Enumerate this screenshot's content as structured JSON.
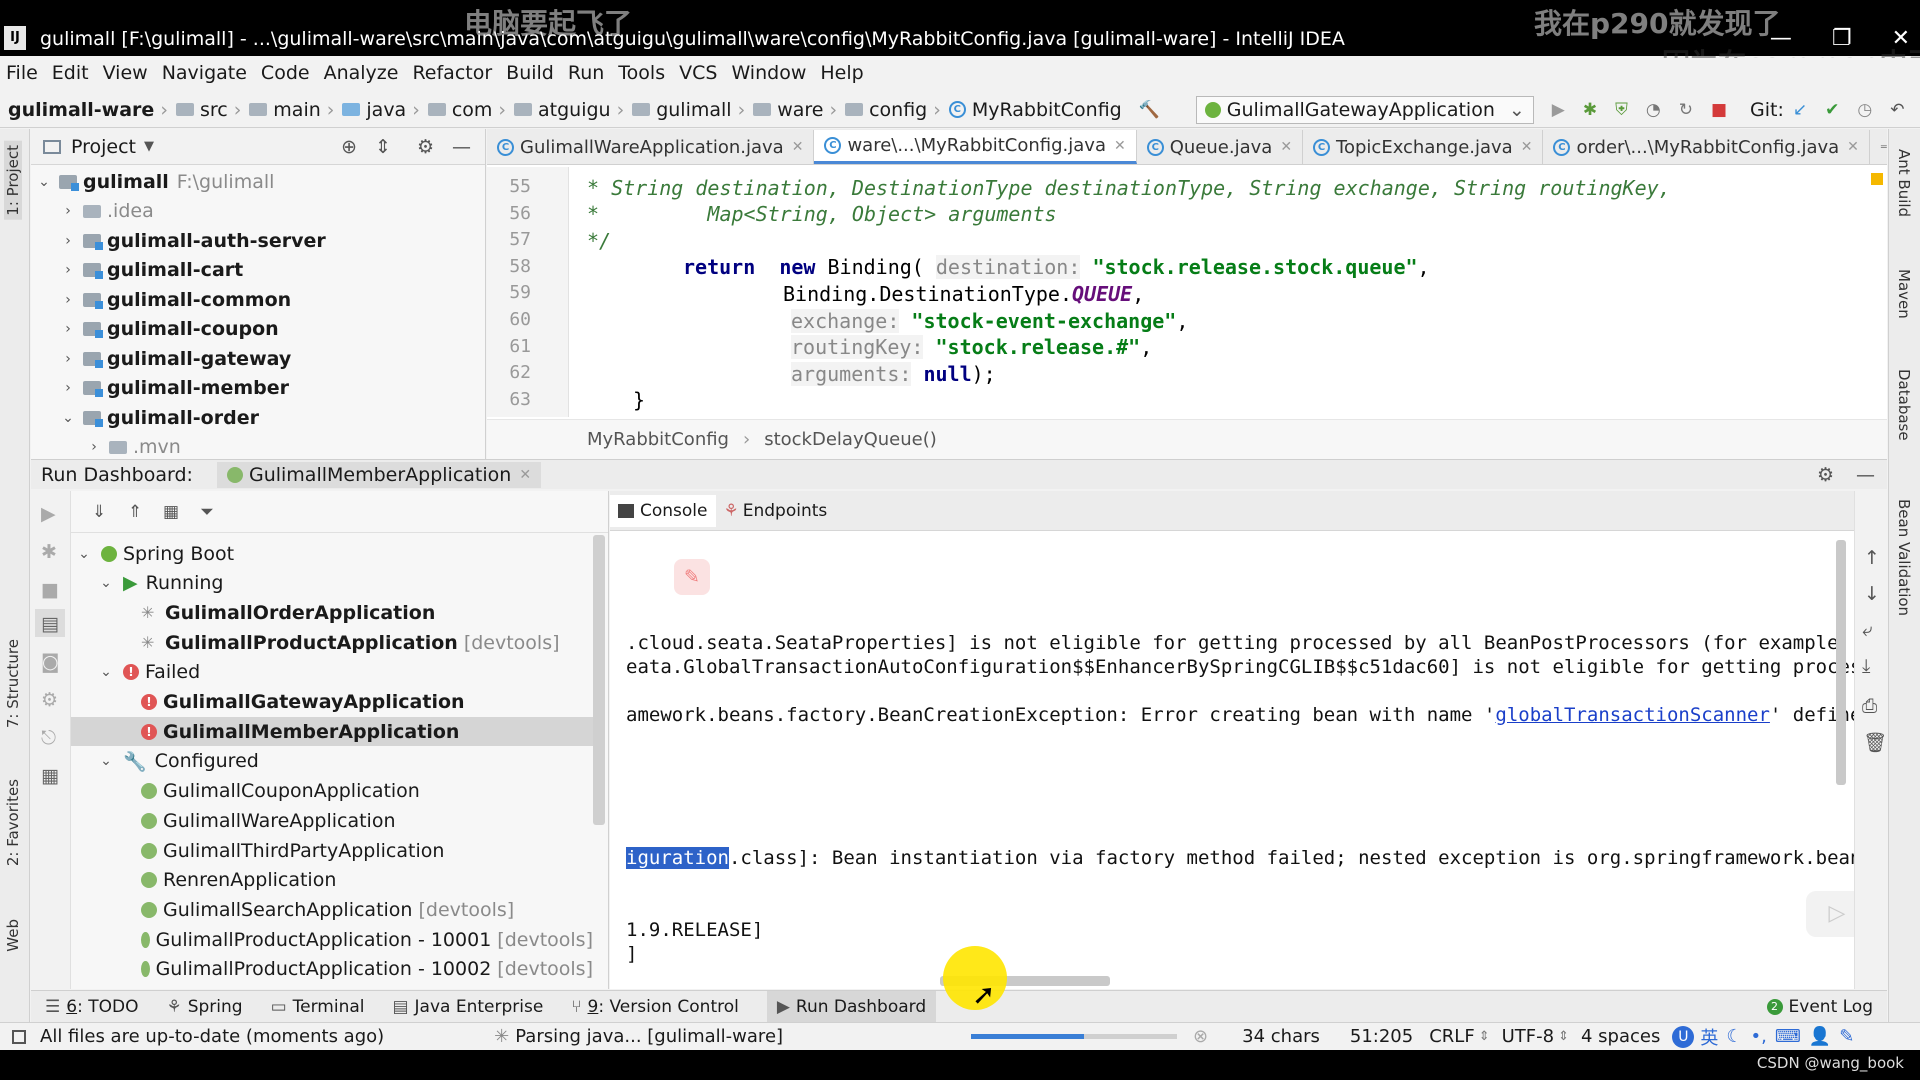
{
  "window": {
    "title": "gulimall [F:\\gulimall] - ...\\gulimall-ware\\src\\main\\java\\com\\atguigu\\gulimall\\ware\\config\\MyRabbitConfig.java [gulimall-ware] - IntelliJ IDEA",
    "logo": "IJ"
  },
  "overlays": {
    "top_center": "电脑要起飞了",
    "top_right_1": "我在p290就发现了",
    "top_right_2": "因为在common中引入"
  },
  "menu": [
    "File",
    "Edit",
    "View",
    "Navigate",
    "Code",
    "Analyze",
    "Refactor",
    "Build",
    "Run",
    "Tools",
    "VCS",
    "Window",
    "Help"
  ],
  "breadcrumbs": [
    "gulimall-ware",
    "src",
    "main",
    "java",
    "com",
    "atguigu",
    "gulimall",
    "ware",
    "config",
    "MyRabbitConfig"
  ],
  "run_config": "GulimallGatewayApplication",
  "git_label": "Git:",
  "project": {
    "header": "Project",
    "root": {
      "name": "gulimall",
      "path": "F:\\gulimall"
    },
    "items": [
      ".idea",
      "gulimall-auth-server",
      "gulimall-cart",
      "gulimall-common",
      "gulimall-coupon",
      "gulimall-gateway",
      "gulimall-member",
      "gulimall-order",
      ".mvn"
    ]
  },
  "editor": {
    "tabs": [
      "GulimallWareApplication.java",
      "ware\\...\\MyRabbitConfig.java",
      "Queue.java",
      "TopicExchange.java",
      "order\\...\\MyRabbitConfig.java"
    ],
    "tab_count": "2",
    "line_numbers": [
      "55",
      "56",
      "57",
      "58",
      "59",
      "60",
      "61",
      "62",
      "63"
    ],
    "code": {
      "l55": "* String destination, DestinationType destinationType, String exchange, String routingKey,",
      "l56": "*         Map<String, Object> arguments",
      "l57": "*/",
      "l58_kw": "return",
      "l58_new": "new",
      "l58_cls": "Binding(",
      "l58_hint": "destination:",
      "l58_str": "\"stock.release.stock.queue\"",
      "l59_a": "Binding.DestinationType.",
      "l59_c": "QUEUE",
      "l60_hint": "exchange:",
      "l60_str": "\"stock-event-exchange\"",
      "l61_hint": "routingKey:",
      "l61_str": "\"stock.release.#\"",
      "l62_hint": "arguments:",
      "l62_val": "null",
      "l63": "}"
    },
    "breadcrumb": [
      "MyRabbitConfig",
      "stockDelayQueue()"
    ]
  },
  "run_dashboard": {
    "title": "Run Dashboard:",
    "tab": "GulimallMemberApplication",
    "tree": {
      "spring_boot": "Spring Boot",
      "running": "Running",
      "running_apps": [
        {
          "name": "GulimallOrderApplication",
          "tag": ""
        },
        {
          "name": "GulimallProductApplication",
          "tag": "[devtools]"
        }
      ],
      "failed": "Failed",
      "failed_apps": [
        "GulimallGatewayApplication",
        "GulimallMemberApplication"
      ],
      "configured": "Configured",
      "configured_apps": [
        {
          "name": "GulimallCouponApplication",
          "tag": ""
        },
        {
          "name": "GulimallWareApplication",
          "tag": ""
        },
        {
          "name": "GulimallThirdPartyApplication",
          "tag": ""
        },
        {
          "name": "RenrenApplication",
          "tag": ""
        },
        {
          "name": "GulimallSearchApplication",
          "tag": "[devtools]"
        },
        {
          "name": "GulimallProductApplication - 10001",
          "tag": "[devtools]"
        },
        {
          "name": "GulimallProductApplication - 10002",
          "tag": "[devtools]"
        }
      ]
    }
  },
  "console": {
    "tabs": [
      "Console",
      "Endpoints"
    ],
    "lines": {
      "l1": ".cloud.seata.SeataProperties] is not eligible for getting processed by all BeanPostProcessors (for example: n",
      "l2": "eata.GlobalTransactionAutoConfiguration$$EnhancerBySpringCGLIB$$c51dac60] is not eligible for getting process",
      "l3_a": "amework.beans.factory.BeanCreationException: Error creating bean with name '",
      "l3_link": "globalTransactionScanner",
      "l3_b": "' defined",
      "l4_hl": "iguration",
      "l4_b": ".class]: Bean instantiation via factory method failed; nested exception is org.springframework.beans",
      "l5": "1.9.RELEASE]",
      "l6": "]"
    }
  },
  "bottom_tools": [
    {
      "num": "6",
      "label": ": TODO"
    },
    {
      "num": "",
      "label": "Spring"
    },
    {
      "num": "",
      "label": "Terminal"
    },
    {
      "num": "",
      "label": "Java Enterprise"
    },
    {
      "num": "9",
      "label": ": Version Control"
    },
    {
      "num": "",
      "label": "Run Dashboard"
    }
  ],
  "event_log": "Event Log",
  "status": {
    "message": "All files are up-to-date (moments ago)",
    "progress_label": "Parsing java... [gulimall-ware]",
    "progress": 0.55,
    "chars": "34 chars",
    "position": "51:205",
    "line_sep": "CRLF",
    "encoding": "UTF-8",
    "indent": "4 spaces",
    "ime": "英"
  },
  "right_tabs": [
    "Ant Build",
    "Maven",
    "Database",
    "Bean Validation"
  ],
  "left_tabs": [
    "1: Project",
    "7: Structure",
    "2: Favorites",
    "Web"
  ],
  "watermark": "CSDN @wang_book",
  "colors": {
    "accent": "#4a88d6",
    "error": "#e05555",
    "spring": "#6db33f",
    "string": "#067d17",
    "keyword": "#000080"
  }
}
